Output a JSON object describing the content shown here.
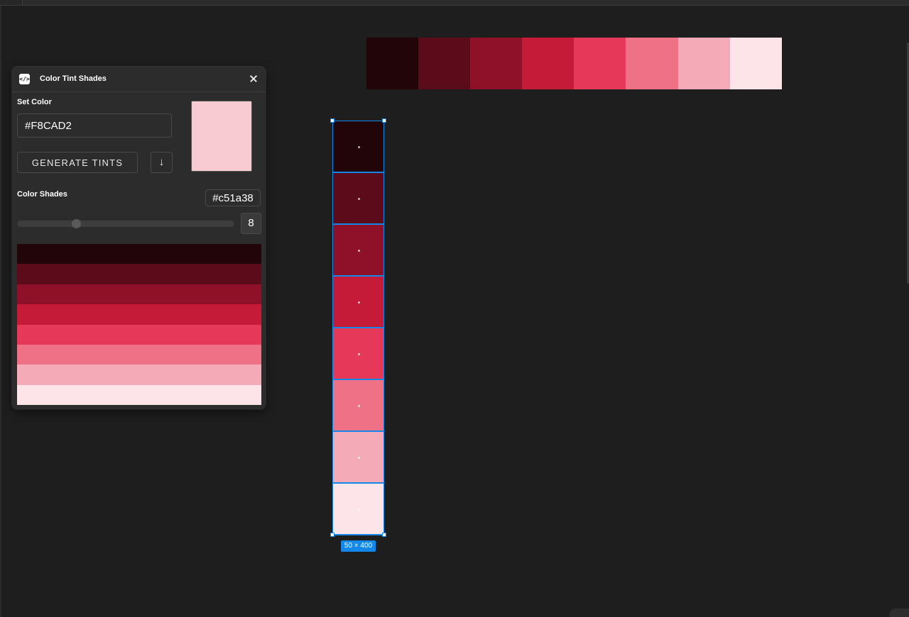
{
  "plugin": {
    "title": "Color Tint Shades",
    "icon": "code-icon",
    "icon_glyph": "</>",
    "set_color_label": "Set Color",
    "hex_value": "#F8CAD2",
    "preview_color": "#F8CAD2",
    "generate_label": "GENERATE TINTS",
    "download_glyph": "↓",
    "shades_label": "Color Shades",
    "shade_hex": "#c51a38",
    "shade_count": "8",
    "slider_fraction": 0.27,
    "shades": [
      "#220509",
      "#5b0b19",
      "#8e1129",
      "#c51a38",
      "#e6395a",
      "#ee7186",
      "#f5aab7",
      "#fce4e8"
    ]
  },
  "canvas": {
    "selection_size_label": "50 × 400",
    "horizontal_palette": [
      "#220509",
      "#5b0b19",
      "#8e1129",
      "#c51a38",
      "#e6395a",
      "#ee7186",
      "#f5aab7",
      "#fce4e8"
    ],
    "vertical_palette": [
      "#220509",
      "#5b0b19",
      "#8e1129",
      "#c51a38",
      "#e6395a",
      "#ee7186",
      "#f5aab7",
      "#fce4e8"
    ],
    "selection_color": "#1488e8"
  }
}
